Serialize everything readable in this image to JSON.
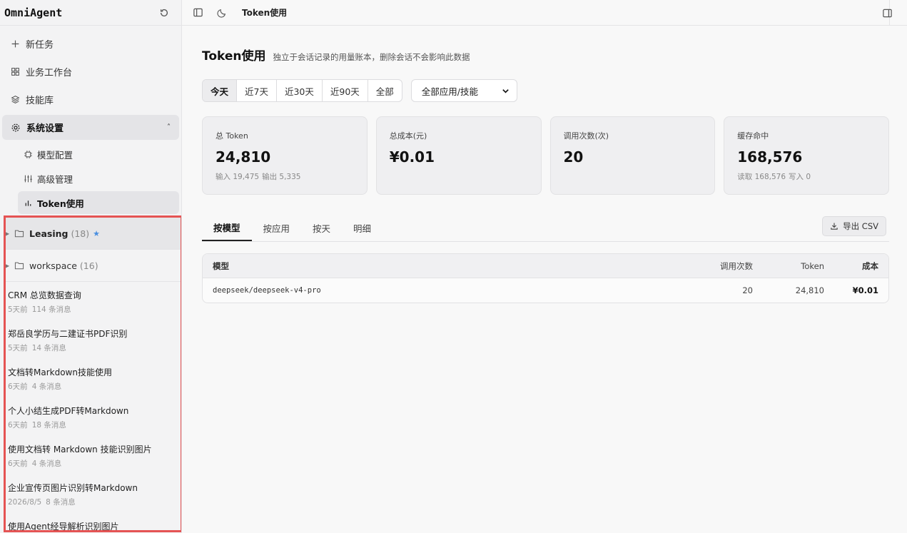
{
  "app": {
    "name": "OmniAgent"
  },
  "nav": {
    "items": [
      {
        "label": "新任务",
        "icon": "plus-icon"
      },
      {
        "label": "业务工作台",
        "icon": "grid-icon"
      },
      {
        "label": "技能库",
        "icon": "layers-icon"
      },
      {
        "label": "系统设置",
        "icon": "gear-icon"
      }
    ],
    "settings_sub": [
      {
        "label": "模型配置",
        "icon": "chip-icon"
      },
      {
        "label": "高级管理",
        "icon": "sliders-icon"
      },
      {
        "label": "Token使用",
        "icon": "bar-chart-icon"
      }
    ]
  },
  "history": {
    "folders": [
      {
        "name": "Leasing",
        "count": "(18)",
        "star": "★"
      },
      {
        "name": "workspace",
        "count": "(16)",
        "star": ""
      }
    ],
    "conversations": [
      {
        "title": "CRM 总览数据查询",
        "time": "5天前",
        "messages": "114 条消息"
      },
      {
        "title": "郑岳良学历与二建证书PDF识别",
        "time": "5天前",
        "messages": "14 条消息"
      },
      {
        "title": "文档转Markdown技能使用",
        "time": "6天前",
        "messages": "4 条消息"
      },
      {
        "title": "个人小结生成PDF转Markdown",
        "time": "6天前",
        "messages": "18 条消息"
      },
      {
        "title": "使用文档转 Markdown 技能识别图片",
        "time": "6天前",
        "messages": "4 条消息"
      },
      {
        "title": "企业宣传页图片识别转Markdown",
        "time": "2026/8/5",
        "messages": "8 条消息"
      },
      {
        "title": "使用Agent经导解析识别图片",
        "time": "",
        "messages": ""
      }
    ]
  },
  "topbar": {
    "breadcrumb": "Token使用"
  },
  "page": {
    "title": "Token使用",
    "subtitle": "独立于会话记录的用量账本，删除会话不会影响此数据"
  },
  "filters": {
    "ranges": [
      "今天",
      "近7天",
      "近30天",
      "近90天",
      "全部"
    ],
    "selected_range": "今天",
    "scope_value": "全部应用/技能"
  },
  "cards": [
    {
      "label": "总 Token",
      "value": "24,810",
      "detail_a": "输入 19,475",
      "detail_b": "输出 5,335"
    },
    {
      "label": "总成本(元)",
      "value": "¥0.01",
      "detail_a": "",
      "detail_b": ""
    },
    {
      "label": "调用次数(次)",
      "value": "20",
      "detail_a": "",
      "detail_b": ""
    },
    {
      "label": "缓存命中",
      "value": "168,576",
      "detail_a": "读取 168,576",
      "detail_b": "写入 0"
    }
  ],
  "tabs": [
    "按模型",
    "按应用",
    "按天",
    "明细"
  ],
  "export_label": "导出 CSV",
  "table": {
    "headers": {
      "model": "模型",
      "calls": "调用次数",
      "token": "Token",
      "cost": "成本"
    },
    "rows": [
      {
        "model": "deepseek/deepseek-v4-pro",
        "calls": "20",
        "token": "24,810",
        "cost": "¥0.01"
      }
    ]
  }
}
